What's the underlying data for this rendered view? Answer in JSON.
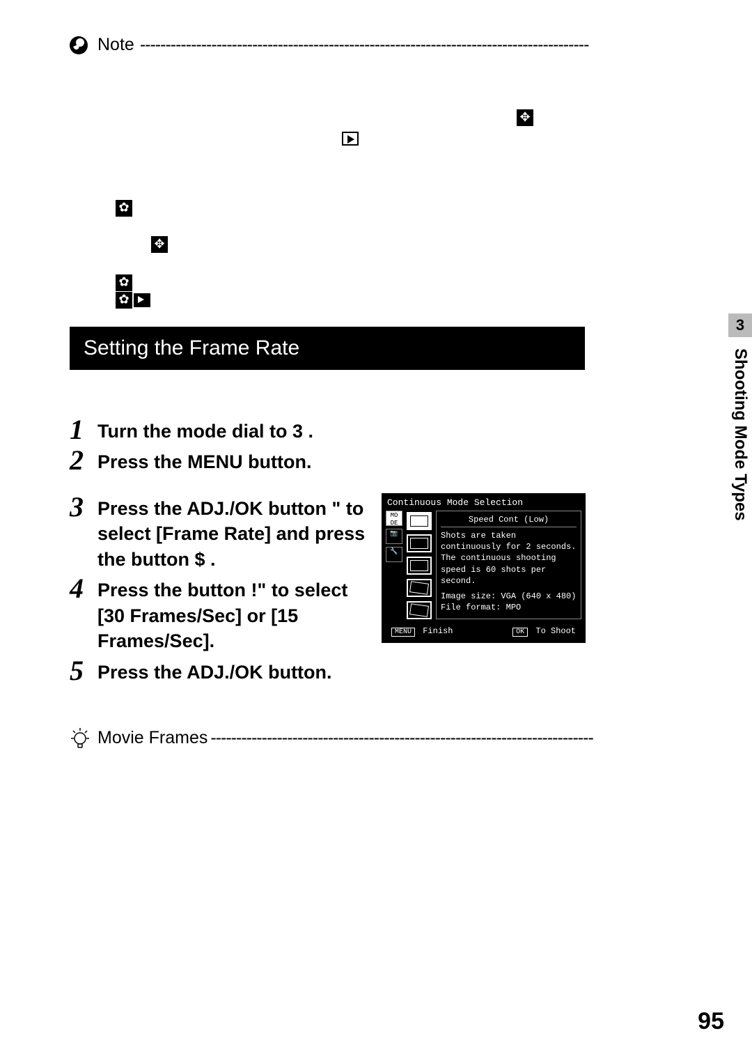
{
  "note": {
    "label": "Note",
    "dashes": "----------------------------------------------------------------------------------------"
  },
  "section_bar": "Setting the Frame Rate",
  "steps": {
    "s1": "Turn the mode dial to 3 .",
    "s2": "Press the MENU button.",
    "s2_sub": "",
    "s3": "Press the ADJ./OK button \"  to select [Frame Rate] and press the button $ .",
    "s4": "Press the button !\"   to select [30 Frames/Sec] or [15 Frames/Sec].",
    "s5": "Press the ADJ./OK button."
  },
  "lcd": {
    "title": "Continuous Mode Selection",
    "left_tabs": [
      "MO\nDE",
      "",
      ""
    ],
    "option_title": "Speed Cont (Low)",
    "desc1": "Shots are taken continuously for 2 seconds.",
    "desc2": "The continuous shooting speed is 60 shots per second.",
    "desc3": "Image size: VGA (640 x 480)",
    "desc4": "File format: MPO",
    "foot_left_btn": "MENU",
    "foot_left": "Finish",
    "foot_right_btn": "OK",
    "foot_right": "To Shoot"
  },
  "tip": {
    "label": "Movie Frames",
    "dashes": "---------------------------------------------------------------------------"
  },
  "side": {
    "chapter": "3",
    "caption": "Shooting Mode Types"
  },
  "page_number": "95"
}
